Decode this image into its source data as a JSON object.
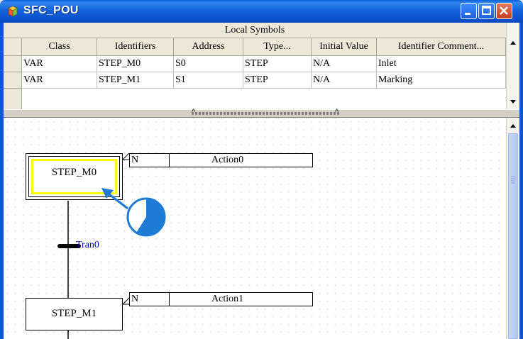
{
  "window": {
    "title": "SFC_POU"
  },
  "symbols_table": {
    "caption": "Local Symbols",
    "columns": [
      "Class",
      "Identifiers",
      "Address",
      "Type...",
      "Initial Value",
      "Identifier Comment..."
    ],
    "rows": [
      [
        "VAR",
        "STEP_M0",
        "S0",
        "STEP",
        "N/A",
        "Inlet"
      ],
      [
        "VAR",
        "STEP_M1",
        "S1",
        "STEP",
        "N/A",
        "Marking"
      ]
    ]
  },
  "sfc": {
    "steps": [
      {
        "name": "STEP_M0",
        "initial": true,
        "selected": true
      },
      {
        "name": "STEP_M1",
        "initial": false,
        "selected": false
      }
    ],
    "actions": [
      {
        "qualifier": "N",
        "name": "Action0"
      },
      {
        "qualifier": "N",
        "name": "Action1"
      }
    ],
    "transitions": [
      {
        "name": "Tran0"
      }
    ]
  },
  "icons": {
    "window_icon": "pou-icon",
    "cursor": "busy-cursor-icon"
  },
  "colors": {
    "titlebar": "#0d54d0",
    "selection": "#ffff00",
    "transition_label": "#0000cc",
    "cursor_outline": "#1e7bd6"
  }
}
